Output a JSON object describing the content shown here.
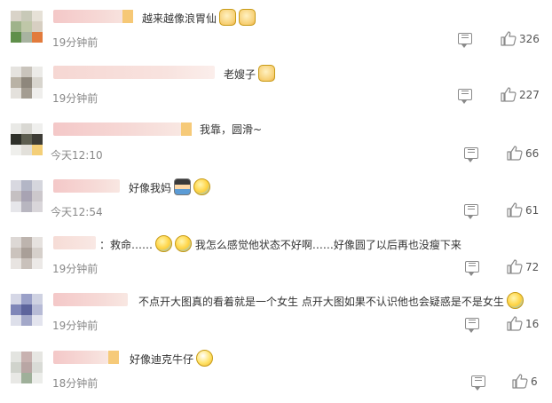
{
  "comments": [
    {
      "time": "19分钟前",
      "likes": "326",
      "text": "越来越像浪胃仙",
      "emojis": [
        {
          "name": "dog-emoji",
          "kind": "dog"
        },
        {
          "name": "dog-emoji",
          "kind": "dog"
        }
      ]
    },
    {
      "time": "19分钟前",
      "likes": "227",
      "text": "老嫂子",
      "emojis": [
        {
          "name": "dog-emoji",
          "kind": "dog"
        }
      ]
    },
    {
      "time": "今天12:10",
      "likes": "66",
      "text": "我靠，圆滑~",
      "emojis": []
    },
    {
      "time": "今天12:54",
      "likes": "61",
      "text": "好像我妈",
      "emojis": [
        {
          "name": "person-emoji",
          "kind": "person"
        },
        {
          "name": "laugh-cry-emoji",
          "kind": "cry"
        }
      ]
    },
    {
      "time": "19分钟前",
      "likes": "72",
      "text_before": "：救命……",
      "text": "我怎么感觉他状态不好啊……好像圆了以后再也没瘦下来",
      "emojis": [
        {
          "name": "cry-emoji",
          "kind": "cry"
        },
        {
          "name": "cry-emoji",
          "kind": "cry"
        }
      ]
    },
    {
      "time": "19分钟前",
      "likes": "16",
      "text": "不点开大图真的看着就是一个女生 点开大图如果不认识他也会疑惑是不是女生",
      "emojis": [
        {
          "name": "facepalm-emoji",
          "kind": "cry"
        }
      ]
    },
    {
      "time": "18分钟前",
      "likes": "6",
      "text": "好像迪克牛仔",
      "emojis": [
        {
          "name": "grin-emoji",
          "kind": "grin"
        }
      ]
    }
  ]
}
